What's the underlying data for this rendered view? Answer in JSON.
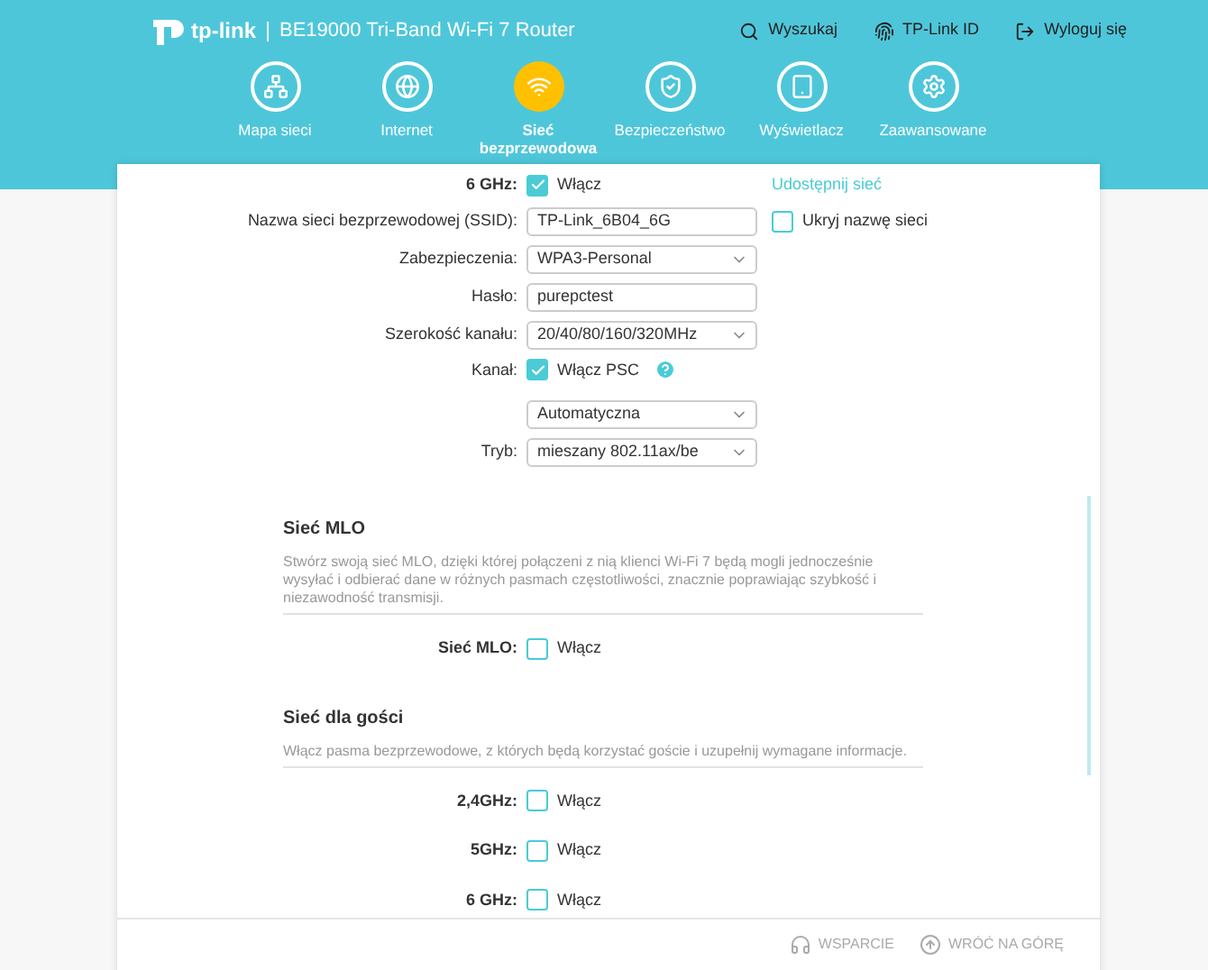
{
  "header": {
    "logo": "tp-link",
    "model": "BE19000 Tri-Band Wi-Fi 7 Router",
    "actions": [
      {
        "kind": "search",
        "label": "Wyszukaj"
      },
      {
        "kind": "id",
        "label": "TP-Link ID"
      },
      {
        "kind": "logout",
        "label": "Wyloguj się"
      }
    ]
  },
  "nav": [
    {
      "kind": "map",
      "label": "Mapa sieci",
      "selected": false
    },
    {
      "kind": "internet",
      "label": "Internet",
      "selected": false
    },
    {
      "kind": "wireless",
      "label": "Sieć bezprzewodowa",
      "selected": true
    },
    {
      "kind": "security",
      "label": "Bezpieczeństwo",
      "selected": false
    },
    {
      "kind": "display",
      "label": "Wyświetlacz",
      "selected": false
    },
    {
      "kind": "advanced",
      "label": "Zaawansowane",
      "selected": false
    }
  ],
  "wireless": [
    {
      "kind": "checkbox",
      "label": "6 GHz:",
      "bold": true,
      "text": "Włącz",
      "checked": true,
      "link": "Udostępnij sieć"
    },
    {
      "kind": "input",
      "label": "Nazwa sieci bezprzewodowej (SSID):",
      "value": "TP-Link_6B04_6G",
      "extra": {
        "text": "Ukryj nazwę sieci",
        "checked": false
      }
    },
    {
      "kind": "select",
      "label": "Zabezpieczenia:",
      "value": "WPA3-Personal"
    },
    {
      "kind": "input",
      "label": "Hasło:",
      "value": "purepctest"
    },
    {
      "kind": "select",
      "label": "Szerokość kanału:",
      "value": "20/40/80/160/320MHz"
    },
    {
      "kind": "checkbox",
      "label": "Kanał:",
      "bold": false,
      "text": "Włącz PSC",
      "checked": true,
      "help": true
    },
    {
      "kind": "select",
      "value": "Automatyczna"
    },
    {
      "kind": "select",
      "label": "Tryb:",
      "value": "mieszany 802.11ax/be"
    }
  ],
  "sections": [
    {
      "title": "Sieć MLO",
      "description": "Stwórz swoją sieć MLO, dzięki której połączeni z nią klienci Wi-Fi 7 będą mogli jednocześnie wysyłać i odbierać dane w różnych pasmach częstotliwości, znacznie poprawiając szybkość i niezawodność transmisji.",
      "rows": [
        {
          "label": "Sieć MLO:",
          "text": "Włącz",
          "checked": false
        }
      ]
    },
    {
      "title": "Sieć dla gości",
      "description": "Włącz pasma bezprzewodowe, z których będą korzystać goście i uzupełnij wymagane informacje.",
      "rows": [
        {
          "label": "2,4GHz:",
          "text": "Włącz",
          "checked": false
        },
        {
          "label": "5GHz:",
          "text": "Włącz",
          "checked": false
        },
        {
          "label": "6 GHz:",
          "text": "Włącz",
          "checked": false
        }
      ]
    }
  ],
  "footer": [
    {
      "kind": "support",
      "label": "WSPARCIE"
    },
    {
      "kind": "top",
      "label": "WRÓĆ NA GÓRĘ"
    }
  ]
}
